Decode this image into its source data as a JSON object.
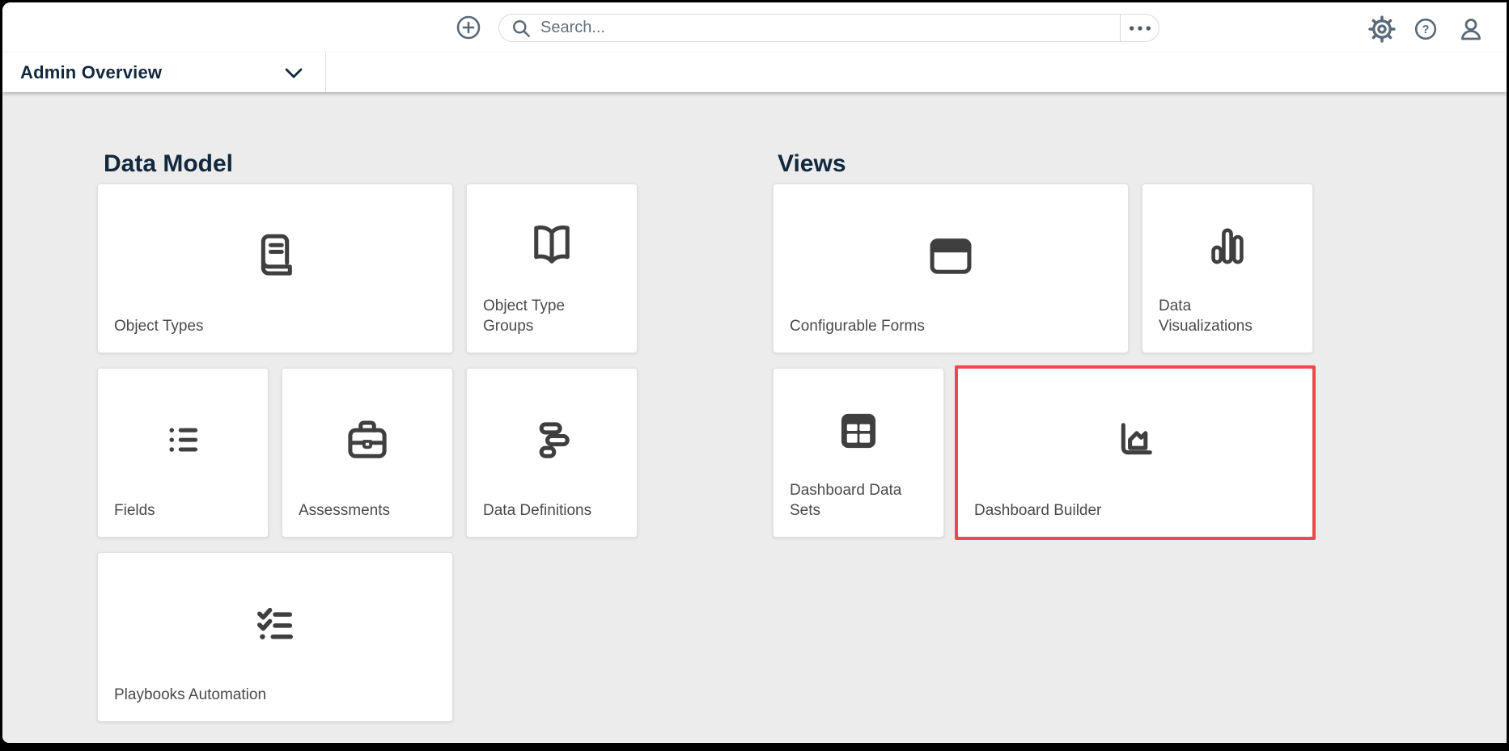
{
  "topbar": {
    "create_button": {
      "icon": "plus-icon"
    },
    "search": {
      "placeholder": "Search...",
      "icon": "search-icon",
      "options_icon": "ellipsis-icon"
    },
    "actions": [
      {
        "name": "settings",
        "icon": "gear-icon"
      },
      {
        "name": "help",
        "icon": "help-icon",
        "glyph": "?"
      },
      {
        "name": "user",
        "icon": "user-icon"
      }
    ]
  },
  "nav": {
    "title": "Admin Overview",
    "dropdown_icon": "chevron-down-icon"
  },
  "sections": [
    {
      "title": "Data Model",
      "cards": [
        {
          "label": "Object Types",
          "icon": "book-icon",
          "size": "wide"
        },
        {
          "label": "Object Type Groups",
          "icon": "open-book-icon",
          "size": "small"
        },
        {
          "label": "Fields",
          "icon": "list-icon",
          "size": "small"
        },
        {
          "label": "Assessments",
          "icon": "briefcase-icon",
          "size": "small"
        },
        {
          "label": "Data Definitions",
          "icon": "stacked-bars-icon",
          "size": "small"
        },
        {
          "label": "Playbooks Automation",
          "icon": "checklist-icon",
          "size": "wide"
        }
      ]
    },
    {
      "title": "Views",
      "cards": [
        {
          "label": "Configurable Forms",
          "icon": "window-icon",
          "size": "wide"
        },
        {
          "label": "Data Visualizations",
          "icon": "bar-chart-icon",
          "size": "small"
        },
        {
          "label": "Dashboard Data Sets",
          "icon": "table-icon",
          "size": "small"
        },
        {
          "label": "Dashboard Builder",
          "icon": "area-chart-icon",
          "size": "wide",
          "highlighted": true
        }
      ]
    }
  ],
  "colors": {
    "accent_red": "#F4464B",
    "icon_slate": "#5A6A78",
    "heading_navy": "#12283D",
    "card_icon_gray": "#3F3F3F",
    "label_gray": "#4A4A4A",
    "body_bg": "#ECECEC"
  }
}
